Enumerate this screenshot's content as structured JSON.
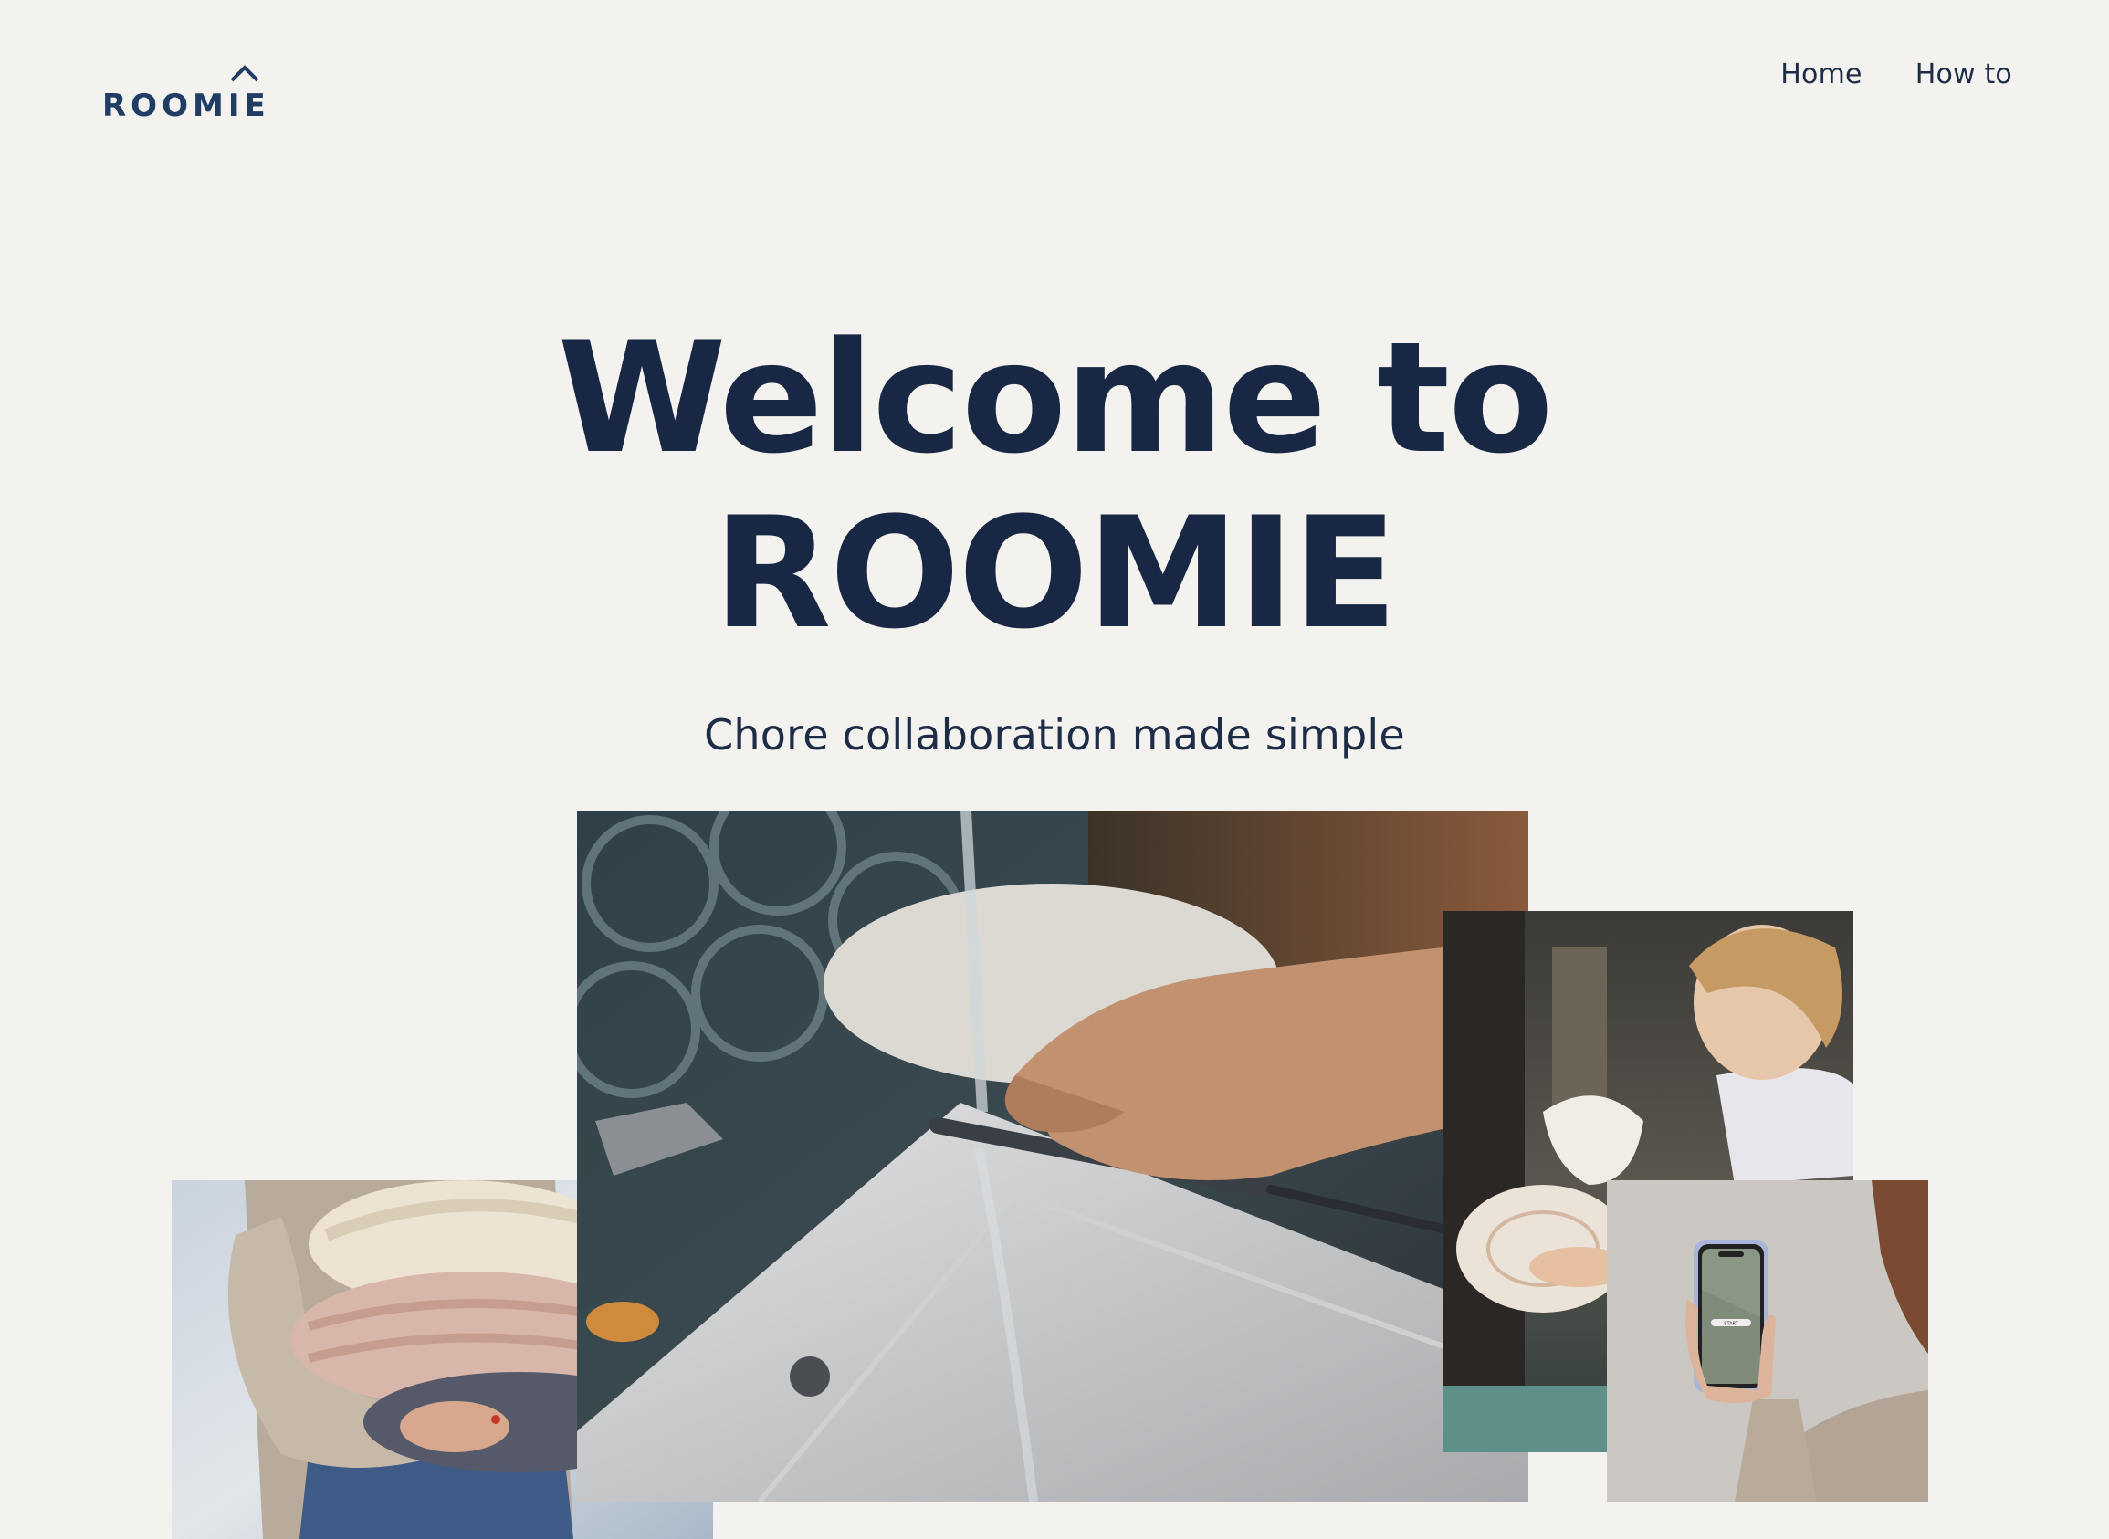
{
  "header": {
    "logo_text": "ROOMIE",
    "nav": [
      {
        "label": "Home"
      },
      {
        "label": "How to"
      }
    ]
  },
  "hero": {
    "title_line1": "Welcome to",
    "title_line2": "ROOMIE",
    "subtitle": "Chore collaboration made simple"
  },
  "phone_screen": {
    "button_label": "START"
  },
  "colors": {
    "background": "#f4f2ee",
    "brand_navy": "#172744",
    "logo_blue": "#1f3d63"
  }
}
